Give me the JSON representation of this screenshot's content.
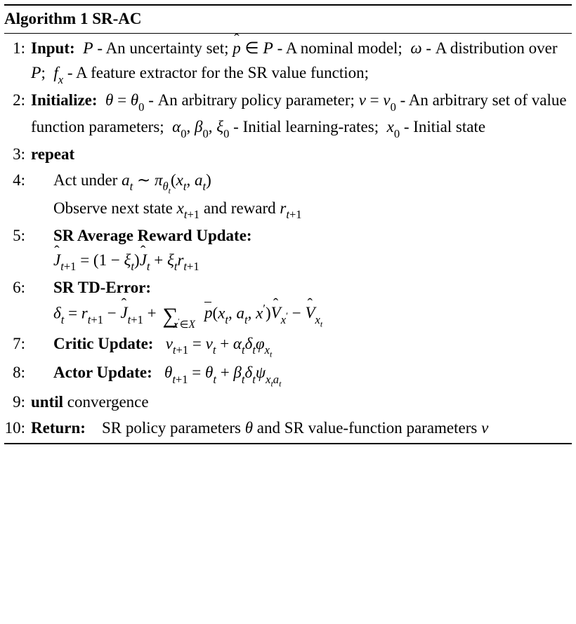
{
  "header": {
    "label": "Algorithm 1",
    "title": "SR-AC"
  },
  "lines": {
    "1": {
      "kw": "Input:",
      "body": "𝒫 - An uncertainty set; p̂ ∈ 𝒫 - A nominal model; ω - A distribution over 𝒫; fₓ - A feature extractor for the SR value function;"
    },
    "2": {
      "kw": "Initialize:",
      "body": "θ = θ₀ - An arbitrary policy parameter; v = v₀ - An arbitrary set of value function parameters; α₀, β₀, ξ₀ - Initial learning-rates; x₀ - Initial state"
    },
    "3": {
      "kw": "repeat"
    },
    "4": {
      "act": "Act under aₜ ∼ π_θₜ(xₜ, aₜ)",
      "obs": "Observe next state xₜ₊₁ and reward rₜ₊₁"
    },
    "5": {
      "kw": "SR Average Reward Update:",
      "body": "Ĵₜ₊₁ = (1 − ξₜ)Ĵₜ + ξₜrₜ₊₁"
    },
    "6": {
      "kw": "SR TD-Error:",
      "body": "δₜ = rₜ₊₁ − Ĵₜ₊₁ + Σ_{x'∈𝒳} p̄(xₜ, aₜ, x')V̂_{x'} − V̂_{xₜ}"
    },
    "7": {
      "kw": "Critic Update:",
      "body": "vₜ₊₁ = vₜ + αₜδₜφ_{xₜ}"
    },
    "8": {
      "kw": "Actor Update:",
      "body": "θₜ₊₁ = θₜ + βₜδₜψ_{xₜaₜ}"
    },
    "9": {
      "kw": "until",
      "cond": "convergence"
    },
    "10": {
      "kw": "Return:",
      "body": "SR policy parameters θ and SR value-function parameters v"
    }
  },
  "chart_data": {
    "type": "table",
    "title": "Algorithm 1 SR-AC pseudocode",
    "rows": [
      {
        "step": 1,
        "op": "Input",
        "detail": "Uncertainty set P; nominal model p-hat in P; distribution omega over P; feature extractor f_x for SR value function"
      },
      {
        "step": 2,
        "op": "Initialize",
        "detail": "theta=theta_0 arbitrary policy param; v=v_0 arbitrary value-function params; alpha_0,beta_0,xi_0 initial learning rates; x_0 initial state"
      },
      {
        "step": 3,
        "op": "repeat",
        "detail": ""
      },
      {
        "step": 4,
        "op": "Act/Observe",
        "detail": "a_t ~ pi_{theta_t}(x_t,a_t); observe x_{t+1}, r_{t+1}"
      },
      {
        "step": 5,
        "op": "SR Average Reward Update",
        "detail": "J-hat_{t+1} = (1-xi_t) J-hat_t + xi_t r_{t+1}"
      },
      {
        "step": 6,
        "op": "SR TD-Error",
        "detail": "delta_t = r_{t+1} - J-hat_{t+1} + sum_{x' in X} p-bar(x_t,a_t,x') V-hat_{x'} - V-hat_{x_t}"
      },
      {
        "step": 7,
        "op": "Critic Update",
        "detail": "v_{t+1} = v_t + alpha_t delta_t phi_{x_t}"
      },
      {
        "step": 8,
        "op": "Actor Update",
        "detail": "theta_{t+1} = theta_t + beta_t delta_t psi_{x_t a_t}"
      },
      {
        "step": 9,
        "op": "until",
        "detail": "convergence"
      },
      {
        "step": 10,
        "op": "Return",
        "detail": "SR policy parameters theta and SR value-function parameters v"
      }
    ]
  }
}
